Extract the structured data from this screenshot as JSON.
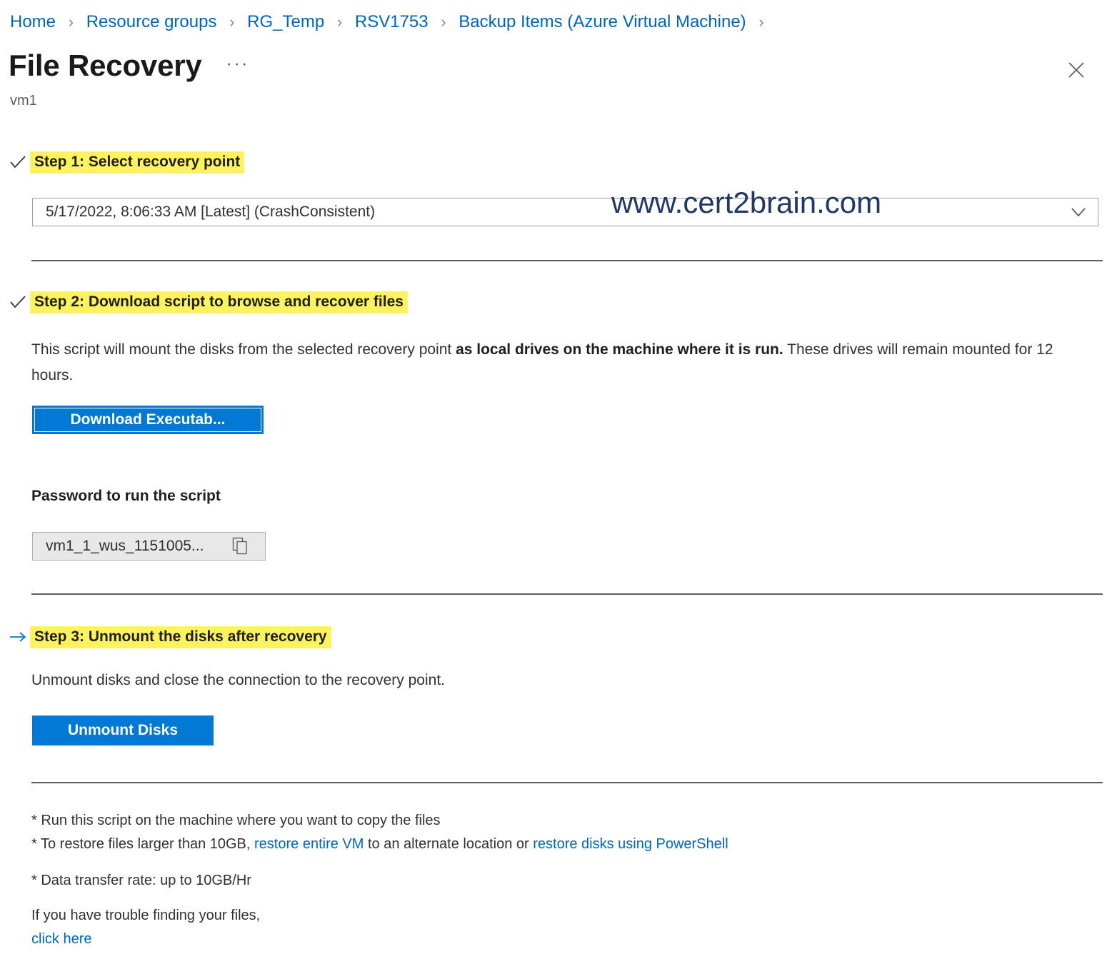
{
  "breadcrumb": {
    "items": [
      {
        "label": "Home"
      },
      {
        "label": "Resource groups"
      },
      {
        "label": "RG_Temp"
      },
      {
        "label": "RSV1753"
      },
      {
        "label": "Backup Items (Azure Virtual Machine)"
      }
    ],
    "separator": "›"
  },
  "header": {
    "title": "File Recovery",
    "more_label": "···",
    "subtitle": "vm1",
    "close_label": "✕"
  },
  "steps": {
    "step1": {
      "icon": "check-icon",
      "label": "Step 1: Select recovery point",
      "recovery_point": {
        "value": "5/17/2022, 8:06:33 AM [Latest] (CrashConsistent)",
        "chevron": "chevron-down-icon"
      }
    },
    "step2": {
      "icon": "check-icon",
      "label": "Step 2: Download script to browse and recover files",
      "description_part1": "This script will mount the disks from the selected recovery point ",
      "description_bold": "as local drives on the machine where it is run.",
      "description_part2": " These drives will remain mounted for 12 hours.",
      "download_button": "Download Executab...",
      "password_label": "Password to run the script",
      "password_value": "vm1_1_wus_1151005...",
      "copy_icon": "copy-icon"
    },
    "step3": {
      "icon": "arrow-right-icon",
      "label": "Step 3: Unmount the disks after recovery",
      "description": "Unmount disks and close the connection to the recovery point.",
      "unmount_button": "Unmount Disks"
    }
  },
  "footnotes": {
    "note1": "* Run this script on the machine where you want to copy the files",
    "note2_prefix": "* To restore files larger than 10GB, ",
    "note2_link1": "restore entire VM",
    "note2_middle": " to an alternate location or ",
    "note2_link2": "restore disks using PowerShell",
    "note3": "* Data transfer rate: up to 10GB/Hr",
    "trouble_text": "If you have trouble finding your files,",
    "trouble_link": "click here"
  },
  "watermark": {
    "text": "www.cert2brain.com"
  },
  "colors": {
    "accent": "#0078d4",
    "link": "#0067b8",
    "highlight": "#fdf35e",
    "watermark": "#1f3864",
    "arrow": "#0078d4"
  }
}
